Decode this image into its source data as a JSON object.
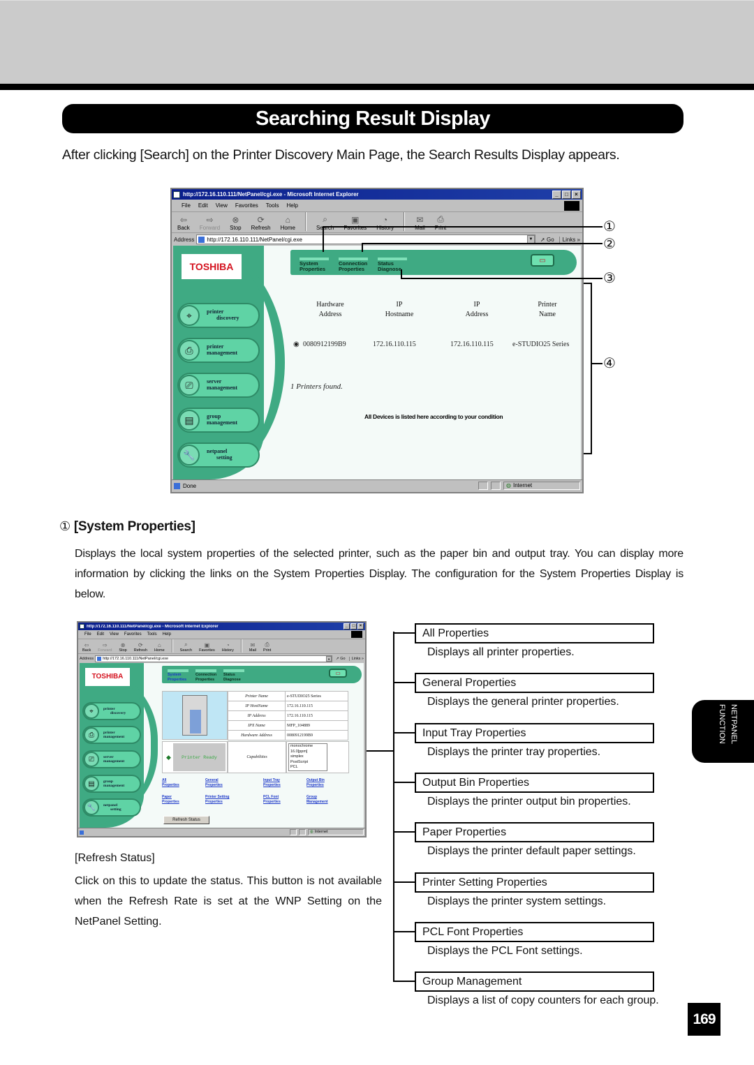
{
  "page": {
    "title": "Searching Result Display",
    "intro": "After clicking [Search] on the Printer Discovery Main Page, the Search Results Display appears.",
    "page_number": "169",
    "side_tab": [
      "NETPANEL",
      "FUNCTION"
    ]
  },
  "browser1": {
    "window_title": "http://172.16.110.111/NetPanel/cgi.exe - Microsoft Internet Explorer",
    "menu": [
      "File",
      "Edit",
      "View",
      "Favorites",
      "Tools",
      "Help"
    ],
    "toolbar": [
      "Back",
      "Forward",
      "Stop",
      "Refresh",
      "Home",
      "Search",
      "Favorites",
      "History",
      "Mail",
      "Print"
    ],
    "address_label": "Address",
    "address_value": "http://172.16.110.111/NetPanel/cgi.exe",
    "go_label": "Go",
    "links_label": "Links »",
    "status_text": "Done",
    "zone_text": "Internet",
    "logo": "TOSHIBA",
    "top_tabs": [
      {
        "line1": "System",
        "line2": "Properties"
      },
      {
        "line1": "Connection",
        "line2": "Properties"
      },
      {
        "line1": "Status",
        "line2": "Diagnose"
      }
    ],
    "nav": [
      {
        "line1": "printer",
        "line2": "discovery"
      },
      {
        "line1": "printer",
        "line2": "management"
      },
      {
        "line1": "server",
        "line2": "management"
      },
      {
        "line1": "group",
        "line2": "management"
      },
      {
        "line1": "netpanel",
        "line2": "setting"
      }
    ],
    "results": {
      "headers": [
        {
          "line1": "Hardware",
          "line2": "Address"
        },
        {
          "line1": "IP",
          "line2": "Hostname"
        },
        {
          "line1": "IP",
          "line2": "Address"
        },
        {
          "line1": "Printer",
          "line2": "Name"
        }
      ],
      "rows": [
        {
          "hardware_address": "0080912199B9",
          "ip_hostname": "172.16.110.115",
          "ip_address": "172.16.110.115",
          "printer_name": "e-STUDIO25 Series",
          "selected": true
        }
      ],
      "found_text": "1 Printers found.",
      "note": "All Devices is listed here according to your condition"
    }
  },
  "callouts": [
    "①",
    "②",
    "③",
    "④"
  ],
  "section1": {
    "heading_num": "①",
    "heading": "[System Properties]",
    "body": "Displays the local system properties of the selected printer, such as the paper bin and output tray.  You can display more information by clicking the links on the System Properties Display.  The configuration for the System Properties Display is below."
  },
  "browser2": {
    "window_title": "http://172.16.110.111/NetPanel/cgi.exe - Microsoft Internet Explorer",
    "menu": [
      "File",
      "Edit",
      "View",
      "Favorites",
      "Tools",
      "Help"
    ],
    "toolbar": [
      "Back",
      "Forward",
      "Stop",
      "Refresh",
      "Home",
      "Search",
      "Favorites",
      "History",
      "Mail",
      "Print"
    ],
    "address_label": "Address",
    "address_value": "http://172.16.110.111/NetPanel/cgi.exe",
    "go_label": "Go",
    "links_label": "Links »",
    "zone_text": "Internet",
    "logo": "TOSHIBA",
    "top_tabs": [
      {
        "line1": "System",
        "line2": "Properties"
      },
      {
        "line1": "Connection",
        "line2": "Properties"
      },
      {
        "line1": "Status",
        "line2": "Diagnose"
      }
    ],
    "nav": [
      {
        "line1": "printer",
        "line2": "discovery"
      },
      {
        "line1": "printer",
        "line2": "management"
      },
      {
        "line1": "server",
        "line2": "management"
      },
      {
        "line1": "group",
        "line2": "management"
      },
      {
        "line1": "netpanel",
        "line2": "setting"
      }
    ],
    "props": [
      {
        "label": "Printer Name",
        "value": "e-STUDIO25 Series"
      },
      {
        "label": "IP HostName",
        "value": "172.16.110.115"
      },
      {
        "label": "IP Address",
        "value": "172.16.110.115"
      },
      {
        "label": "IPX Name",
        "value": "MFP_104889"
      },
      {
        "label": "Hardware Address",
        "value": "0080912199B9"
      }
    ],
    "status": "Printer Ready",
    "capabilities_label": "Capabilities",
    "capabilities": [
      "monochrome",
      "16.0[ppm]",
      "simplex",
      "PostScript",
      "PCL"
    ],
    "links": [
      {
        "line1": "All",
        "line2": "Properties"
      },
      {
        "line1": "General",
        "line2": "Properties"
      },
      {
        "line1": "Input Tray",
        "line2": "Properties"
      },
      {
        "line1": "Output Bin",
        "line2": "Properties"
      },
      {
        "line1": "Paper",
        "line2": "Properties"
      },
      {
        "line1": "Printer Setting",
        "line2": "Properties"
      },
      {
        "line1": "PCL Font",
        "line2": "Properties"
      },
      {
        "line1": "Group",
        "line2": "Management"
      }
    ],
    "refresh_button": "Refresh Status"
  },
  "properties_tree": [
    {
      "label": "All Properties",
      "desc": "Displays all printer properties."
    },
    {
      "label": "General Properties",
      "desc": "Displays the general printer properties."
    },
    {
      "label": "Input Tray Properties",
      "desc": "Displays the printer tray properties."
    },
    {
      "label": "Output Bin Properties",
      "desc": "Displays the printer output bin properties."
    },
    {
      "label": "Paper Properties",
      "desc": "Displays the printer default paper settings."
    },
    {
      "label": "Printer Setting Properties",
      "desc": "Displays the printer system settings."
    },
    {
      "label": "PCL Font Properties",
      "desc": "Displays the PCL Font settings."
    },
    {
      "label": "Group Management",
      "desc": "Displays a list of copy counters for each group."
    }
  ],
  "refresh_section": {
    "heading": "[Refresh Status]",
    "body": "Click on this to update the status.  This button is not available when the Refresh Rate is set at the WNP Setting on the NetPanel Setting."
  }
}
